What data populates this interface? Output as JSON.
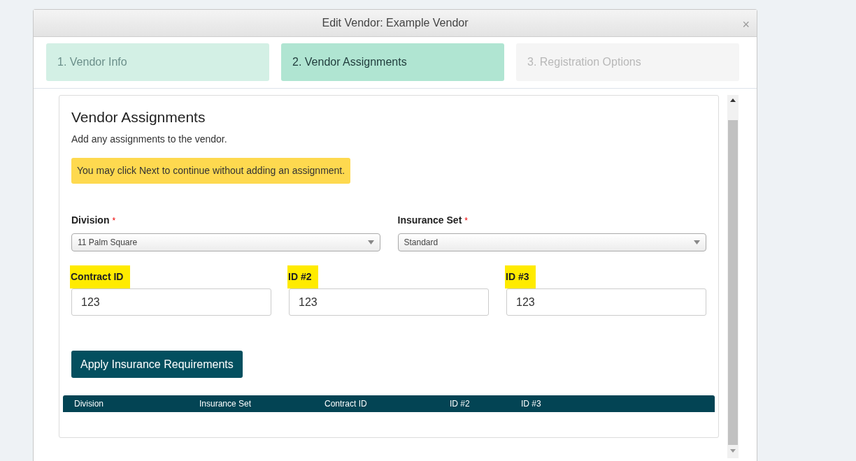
{
  "dialog": {
    "title": "Edit Vendor: Example Vendor",
    "close": "×"
  },
  "steps": [
    {
      "label": "1. Vendor Info",
      "selected": false,
      "disabled": false
    },
    {
      "label": "2. Vendor Assignments",
      "selected": true,
      "disabled": false
    },
    {
      "label": "3. Registration Options",
      "selected": false,
      "disabled": true
    }
  ],
  "section": {
    "heading": "Vendor Assignments",
    "description": "Add any assignments to the vendor.",
    "notice": "You may click Next to continue without adding an assignment."
  },
  "selects": [
    {
      "label": "Division",
      "required_mark": "*",
      "value": "11 Palm Square"
    },
    {
      "label": "Insurance Set",
      "required_mark": "*",
      "value": "Standard"
    }
  ],
  "inputs": [
    {
      "label": "Contract ID",
      "highlighted": true,
      "value": "123"
    },
    {
      "label": "ID #2",
      "highlighted": true,
      "value": "123"
    },
    {
      "label": "ID #3",
      "highlighted": true,
      "value": "123"
    }
  ],
  "apply_button": "Apply Insurance Requirements",
  "table": {
    "columns": [
      "Division",
      "Insurance Set",
      "Contract ID",
      "ID #2",
      "ID #3"
    ]
  }
}
